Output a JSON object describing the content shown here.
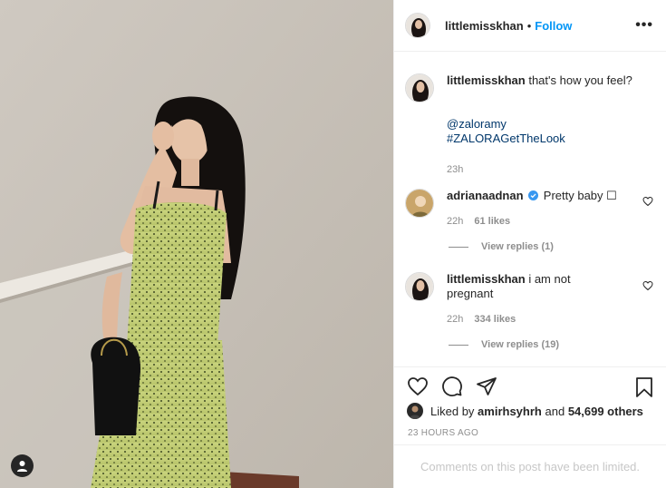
{
  "post": {
    "username": "littlemisskhan",
    "follow_label": "Follow",
    "separator": "•",
    "more_label": "•••"
  },
  "caption": {
    "username": "littlemisskhan",
    "text": "that's how you feel?",
    "mention": "@zaloramy",
    "hashtag": "#ZALORAGetTheLook",
    "time": "23h"
  },
  "comments": [
    {
      "username": "adrianaadnan",
      "verified": true,
      "text": "Pretty baby",
      "emoji": "☐",
      "time": "22h",
      "likes": "61 likes",
      "replies": "View replies (1)"
    },
    {
      "username": "littlemisskhan",
      "verified": false,
      "text": "i am not pregnant",
      "time": "22h",
      "likes": "334 likes",
      "replies": "View replies (19)"
    }
  ],
  "likes_line": {
    "prefix": "Liked by",
    "user": "amirhsyhrh",
    "and": "and",
    "others": "54,699 others"
  },
  "timestamp": "23 HOURS AGO",
  "comments_limited": "Comments on this post have been limited.",
  "colors": {
    "accent": "#0095f6",
    "link": "#00376b",
    "muted": "#8e8e8e",
    "verified": "#3897f0"
  },
  "icons": [
    "heart-icon",
    "comment-icon",
    "share-icon",
    "bookmark-icon",
    "more-icon",
    "user-tag-icon",
    "verified-icon"
  ]
}
